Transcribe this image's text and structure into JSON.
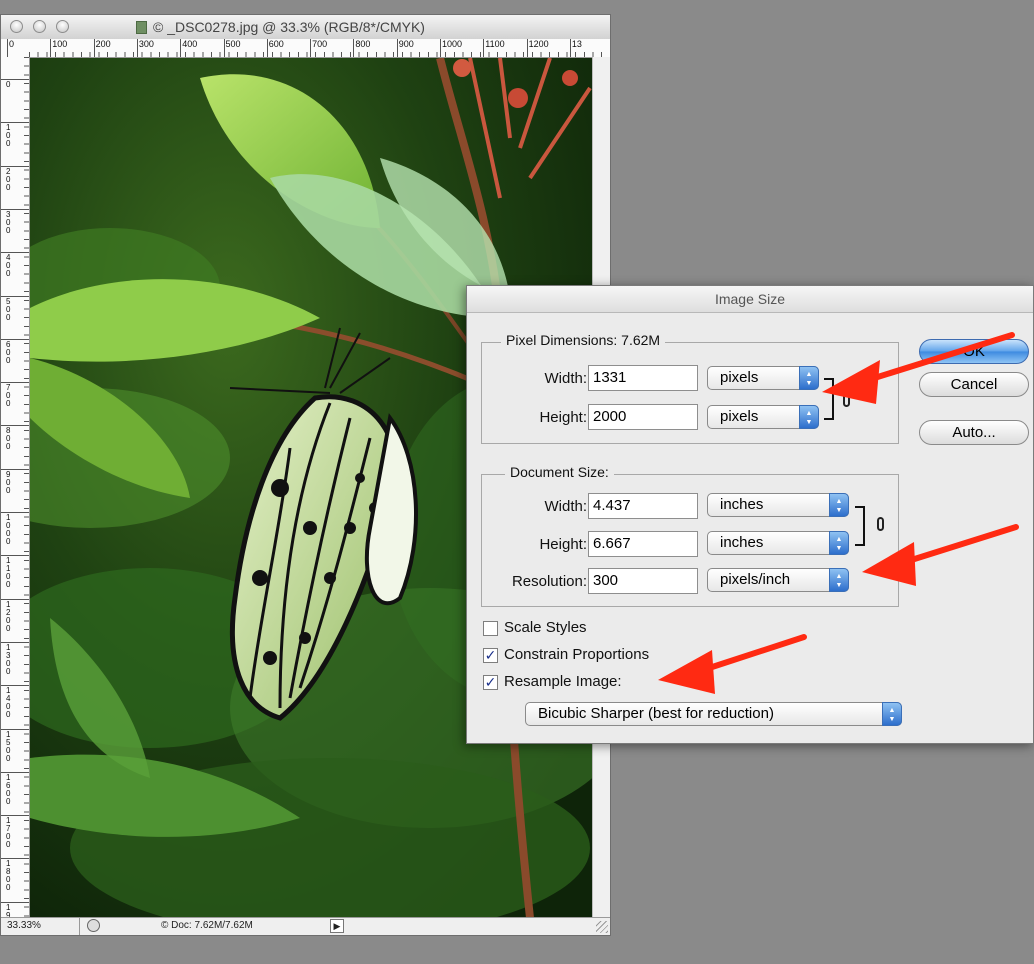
{
  "window": {
    "title": "© _DSC0278.jpg @ 33.3% (RGB/8*/CMYK)",
    "ruler_top_labels": [
      "0",
      "100",
      "200",
      "300",
      "400",
      "500",
      "600",
      "700",
      "800",
      "900",
      "1000",
      "1100",
      "1200",
      "13"
    ],
    "ruler_left_labels": [
      "0",
      "100",
      "200",
      "300",
      "400",
      "500",
      "600",
      "700",
      "800",
      "900",
      "1000",
      "1100",
      "1200",
      "1300",
      "1400",
      "1500",
      "1600",
      "1700",
      "1800",
      "1900"
    ],
    "zoom": "33.33%",
    "doc_info": "© Doc: 7.62M/7.62M"
  },
  "dialog": {
    "title": "Image Size",
    "pixel_dimensions": {
      "legend": "Pixel Dimensions:  7.62M",
      "width_label": "Width:",
      "width_value": "1331",
      "width_unit": "pixels",
      "height_label": "Height:",
      "height_value": "2000",
      "height_unit": "pixels"
    },
    "document_size": {
      "legend": "Document Size:",
      "width_label": "Width:",
      "width_value": "4.437",
      "width_unit": "inches",
      "height_label": "Height:",
      "height_value": "6.667",
      "height_unit": "inches",
      "resolution_label": "Resolution:",
      "resolution_value": "300",
      "resolution_unit": "pixels/inch"
    },
    "buttons": {
      "ok": "OK",
      "cancel": "Cancel",
      "auto": "Auto..."
    },
    "options": {
      "scale_styles": {
        "label": "Scale Styles",
        "checked": false
      },
      "constrain_proportions": {
        "label": "Constrain Proportions",
        "checked": true
      },
      "resample_image": {
        "label": "Resample Image:",
        "checked": true
      },
      "resample_method": "Bicubic Sharper (best for reduction)"
    }
  },
  "colors": {
    "desktop": "#8a8a8a",
    "annotation_arrow": "#ff2a12",
    "aqua_button": "#3d8ae0"
  }
}
